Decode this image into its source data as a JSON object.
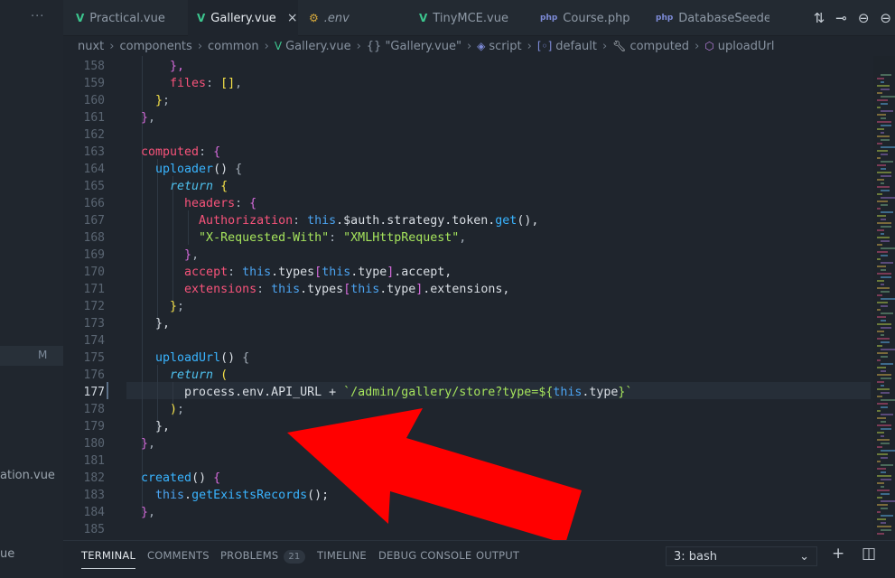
{
  "tabs": [
    {
      "icon": "V",
      "label": "Practical.vue",
      "type": "vue",
      "active": false
    },
    {
      "icon": "V",
      "label": "Gallery.vue",
      "type": "vue",
      "active": true
    },
    {
      "icon": "⚙",
      "label": ".env",
      "type": "env",
      "active": false
    },
    {
      "icon": "V",
      "label": "TinyMCE.vue",
      "type": "vue",
      "active": false
    },
    {
      "icon": "php",
      "label": "Course.php",
      "type": "php",
      "active": false
    },
    {
      "icon": "php",
      "label": "DatabaseSeeder.",
      "type": "php",
      "active": false
    }
  ],
  "tab_close": "×",
  "sidebar": {
    "more": "···",
    "modified_badge": "M",
    "file_1": "ation.vue",
    "file_2": "ue"
  },
  "breadcrumb": [
    "nuxt",
    "components",
    "common",
    "Gallery.vue",
    "{} \"Gallery.vue\"",
    "script",
    "default",
    "computed",
    "uploadUrl"
  ],
  "editor": {
    "current_line": 177,
    "line_numbers": [
      158,
      159,
      160,
      161,
      162,
      163,
      164,
      165,
      166,
      167,
      168,
      169,
      170,
      171,
      172,
      173,
      174,
      175,
      176,
      177,
      178,
      179,
      180,
      181,
      182,
      183,
      184,
      185
    ],
    "lines": [
      {
        "n": 158,
        "segs": [
          [
            "k-br2",
            "      },"
          ]
        ]
      },
      {
        "n": 159,
        "segs": [
          [
            "k-prop",
            "      files"
          ],
          [
            "k-punc",
            ": "
          ],
          [
            "k-br",
            "[]"
          ],
          [
            "k-punc",
            ","
          ]
        ]
      },
      {
        "n": 160,
        "segs": [
          [
            "k-br",
            "    }"
          ],
          [
            "k-punc",
            ";"
          ]
        ]
      },
      {
        "n": 161,
        "segs": [
          [
            "k-br2",
            "  }"
          ],
          [
            "k-punc",
            ","
          ]
        ]
      },
      {
        "n": 162,
        "segs": [
          [
            "k-plain",
            ""
          ]
        ]
      },
      {
        "n": 163,
        "segs": [
          [
            "k-prop",
            "  computed"
          ],
          [
            "k-punc",
            ": "
          ],
          [
            "k-br2",
            "{"
          ]
        ]
      },
      {
        "n": 164,
        "segs": [
          [
            "k-fn",
            "    uploader"
          ],
          [
            "k-plain",
            "() "
          ],
          [
            "k-punc",
            "{"
          ]
        ]
      },
      {
        "n": 165,
        "segs": [
          [
            "k-ital",
            "      return "
          ],
          [
            "k-br",
            "{"
          ]
        ]
      },
      {
        "n": 166,
        "segs": [
          [
            "k-prop",
            "        headers"
          ],
          [
            "k-punc",
            ": "
          ],
          [
            "k-br2",
            "{"
          ]
        ]
      },
      {
        "n": 167,
        "segs": [
          [
            "k-prop",
            "          Authorization"
          ],
          [
            "k-punc",
            ": "
          ],
          [
            "k-this",
            "this"
          ],
          [
            "k-plain",
            ".$auth.strategy.token."
          ],
          [
            "k-fn",
            "get"
          ],
          [
            "k-plain",
            "(),"
          ]
        ]
      },
      {
        "n": 168,
        "segs": [
          [
            "k-str",
            "          \"X-Requested-With\""
          ],
          [
            "k-punc",
            ": "
          ],
          [
            "k-str",
            "\"XMLHttpRequest\""
          ],
          [
            "k-punc",
            ","
          ]
        ]
      },
      {
        "n": 169,
        "segs": [
          [
            "k-br2",
            "        }"
          ],
          [
            "k-punc",
            ","
          ]
        ]
      },
      {
        "n": 170,
        "segs": [
          [
            "k-prop",
            "        accept"
          ],
          [
            "k-punc",
            ": "
          ],
          [
            "k-this",
            "this"
          ],
          [
            "k-plain",
            ".types"
          ],
          [
            "k-br2",
            "["
          ],
          [
            "k-this",
            "this"
          ],
          [
            "k-plain",
            ".type"
          ],
          [
            "k-br2",
            "]"
          ],
          [
            "k-plain",
            ".accept,"
          ]
        ]
      },
      {
        "n": 171,
        "segs": [
          [
            "k-prop",
            "        extensions"
          ],
          [
            "k-punc",
            ": "
          ],
          [
            "k-this",
            "this"
          ],
          [
            "k-plain",
            ".types"
          ],
          [
            "k-br2",
            "["
          ],
          [
            "k-this",
            "this"
          ],
          [
            "k-plain",
            ".type"
          ],
          [
            "k-br2",
            "]"
          ],
          [
            "k-plain",
            ".extensions,"
          ]
        ]
      },
      {
        "n": 172,
        "segs": [
          [
            "k-br",
            "      }"
          ],
          [
            "k-punc",
            ";"
          ]
        ]
      },
      {
        "n": 173,
        "segs": [
          [
            "k-plain",
            "    },"
          ]
        ]
      },
      {
        "n": 174,
        "segs": [
          [
            "k-plain",
            ""
          ]
        ]
      },
      {
        "n": 175,
        "segs": [
          [
            "k-fn",
            "    uploadUrl"
          ],
          [
            "k-plain",
            "() "
          ],
          [
            "k-punc",
            "{"
          ]
        ]
      },
      {
        "n": 176,
        "segs": [
          [
            "k-ital",
            "      return "
          ],
          [
            "k-br",
            "("
          ]
        ]
      },
      {
        "n": 177,
        "segs": [
          [
            "k-plain",
            "        process.env.API_URL + "
          ],
          [
            "k-tpl",
            "`/admin/gallery/store?type=${"
          ],
          [
            "k-this",
            "this"
          ],
          [
            "k-plain",
            ".type"
          ],
          [
            "k-tpl",
            "}`"
          ]
        ]
      },
      {
        "n": 178,
        "segs": [
          [
            "k-br",
            "      )"
          ],
          [
            "k-punc",
            ";"
          ]
        ]
      },
      {
        "n": 179,
        "segs": [
          [
            "k-plain",
            "    },"
          ]
        ]
      },
      {
        "n": 180,
        "segs": [
          [
            "k-br2",
            "  }"
          ],
          [
            "k-punc",
            ","
          ]
        ]
      },
      {
        "n": 181,
        "segs": [
          [
            "k-plain",
            ""
          ]
        ]
      },
      {
        "n": 182,
        "segs": [
          [
            "k-fn",
            "  created"
          ],
          [
            "k-plain",
            "() "
          ],
          [
            "k-br2",
            "{"
          ]
        ]
      },
      {
        "n": 183,
        "segs": [
          [
            "k-this",
            "    this"
          ],
          [
            "k-plain",
            "."
          ],
          [
            "k-fn",
            "getExistsRecords"
          ],
          [
            "k-plain",
            "();"
          ]
        ]
      },
      {
        "n": 184,
        "segs": [
          [
            "k-br2",
            "  }"
          ],
          [
            "k-punc",
            ","
          ]
        ]
      },
      {
        "n": 185,
        "segs": [
          [
            "k-plain",
            ""
          ]
        ]
      }
    ]
  },
  "panel": {
    "tabs": [
      {
        "label": "TERMINAL",
        "active": true
      },
      {
        "label": "COMMENTS",
        "active": false
      },
      {
        "label": "PROBLEMS",
        "active": false,
        "badge": "21"
      },
      {
        "label": "TIMELINE",
        "active": false
      },
      {
        "label": "DEBUG CONSOLE",
        "active": false
      },
      {
        "label": "OUTPUT",
        "active": false
      }
    ],
    "terminal_select": "3: bash",
    "add_label": "+",
    "split_label": "◫"
  },
  "colors": {
    "background": "#1f252d",
    "annotation_arrow": "#ff0000",
    "vue_icon": "#3cc58e"
  }
}
